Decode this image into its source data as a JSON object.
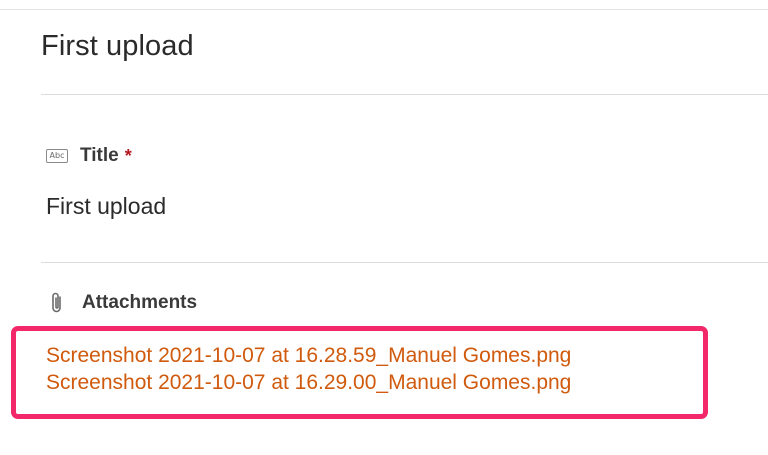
{
  "record": {
    "heading": "First upload"
  },
  "fields": {
    "title": {
      "icon": "text-field-icon",
      "icon_text": "Abc",
      "label": "Title",
      "required_marker": "*",
      "value": "First upload"
    },
    "attachments": {
      "icon": "paperclip-icon",
      "label": "Attachments",
      "files": [
        "Screenshot 2021-10-07 at 16.28.59_Manuel Gomes.png",
        "Screenshot 2021-10-07 at 16.29.00_Manuel Gomes.png"
      ]
    }
  },
  "colors": {
    "link": "#d05a0d",
    "highlight": "#f2286b",
    "required": "#b5171f"
  }
}
